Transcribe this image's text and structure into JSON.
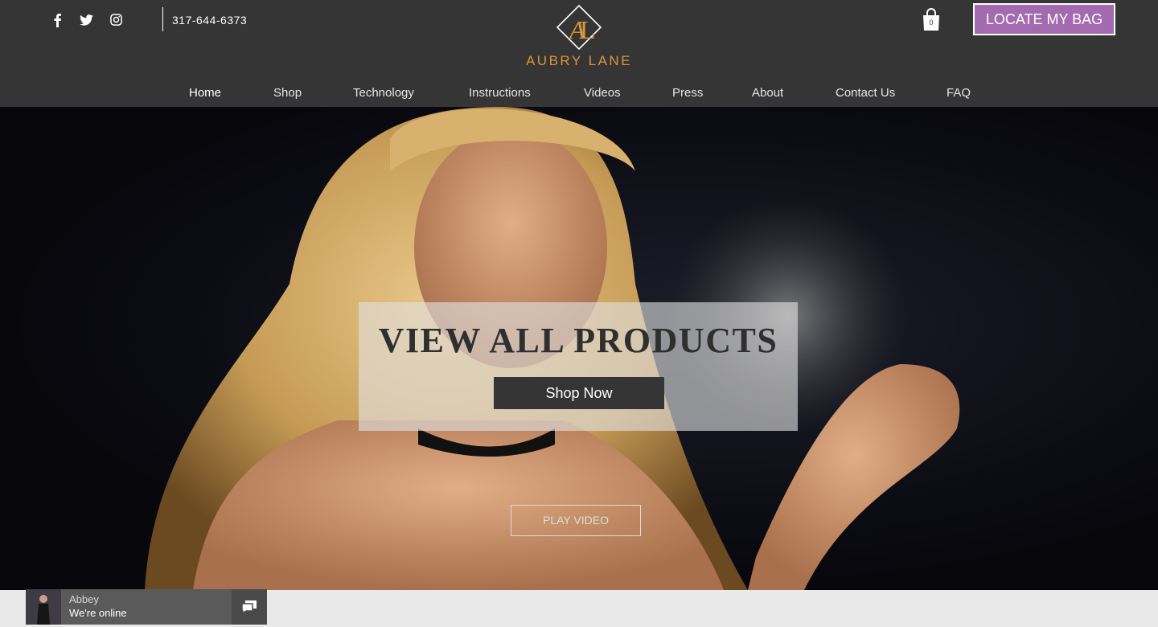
{
  "header": {
    "social": [
      {
        "name": "facebook-icon"
      },
      {
        "name": "twitter-icon"
      },
      {
        "name": "instagram-icon"
      }
    ],
    "phone": "317-644-6373",
    "logo": {
      "monogram": "AL",
      "brand": "AUBRY LANE"
    },
    "cart": {
      "count": "0"
    },
    "locate_button": "LOCATE MY BAG"
  },
  "nav": {
    "items": [
      {
        "label": "Home",
        "active": true
      },
      {
        "label": "Shop"
      },
      {
        "label": "Technology"
      },
      {
        "label": "Instructions"
      },
      {
        "label": "Videos"
      },
      {
        "label": "Press"
      },
      {
        "label": "About"
      },
      {
        "label": "Contact Us"
      },
      {
        "label": "FAQ"
      }
    ]
  },
  "hero": {
    "title": "VIEW ALL PRODUCTS",
    "cta": "Shop Now",
    "play": "PLAY VIDEO"
  },
  "chat": {
    "name": "Abbey",
    "status": "We're online"
  },
  "colors": {
    "header_bg": "#353535",
    "accent_gold": "#d9963a",
    "locate_purple": "#a46aaf"
  }
}
